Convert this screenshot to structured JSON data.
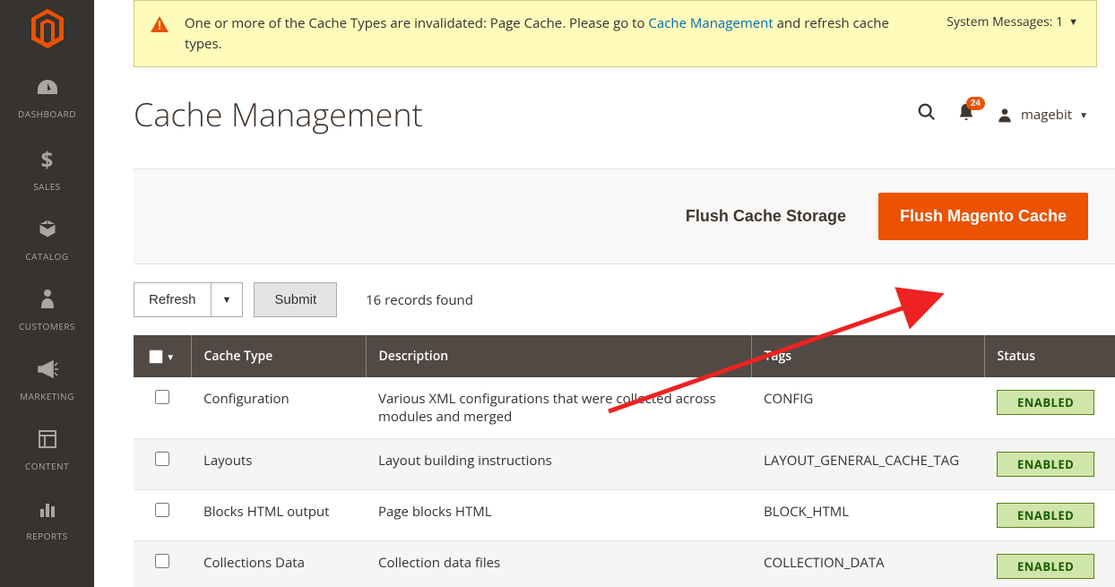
{
  "sidebar": {
    "items": [
      {
        "label": "DASHBOARD",
        "icon": "dashboard"
      },
      {
        "label": "SALES",
        "icon": "dollar"
      },
      {
        "label": "CATALOG",
        "icon": "box"
      },
      {
        "label": "CUSTOMERS",
        "icon": "person"
      },
      {
        "label": "MARKETING",
        "icon": "megaphone"
      },
      {
        "label": "CONTENT",
        "icon": "layout"
      },
      {
        "label": "REPORTS",
        "icon": "bars"
      }
    ]
  },
  "system_message": {
    "text_before": "One or more of the Cache Types are invalidated: Page Cache. Please go to ",
    "link_text": "Cache Management",
    "text_after": " and refresh cache types.",
    "count_label": "System Messages: 1"
  },
  "header": {
    "title": "Cache Management",
    "notifications": "24",
    "username": "magebit"
  },
  "actions": {
    "flush_storage": "Flush Cache Storage",
    "flush_magento": "Flush Magento Cache"
  },
  "toolbar": {
    "refresh_label": "Refresh",
    "submit_label": "Submit",
    "records_text": "16 records found"
  },
  "grid": {
    "columns": {
      "cache_type": "Cache Type",
      "description": "Description",
      "tags": "Tags",
      "status": "Status"
    },
    "rows": [
      {
        "type": "Configuration",
        "desc": "Various XML configurations that were collected across modules and merged",
        "tags": "CONFIG",
        "status": "ENABLED"
      },
      {
        "type": "Layouts",
        "desc": "Layout building instructions",
        "tags": "LAYOUT_GENERAL_CACHE_TAG",
        "status": "ENABLED"
      },
      {
        "type": "Blocks HTML output",
        "desc": "Page blocks HTML",
        "tags": "BLOCK_HTML",
        "status": "ENABLED"
      },
      {
        "type": "Collections Data",
        "desc": "Collection data files",
        "tags": "COLLECTION_DATA",
        "status": "ENABLED"
      }
    ]
  }
}
